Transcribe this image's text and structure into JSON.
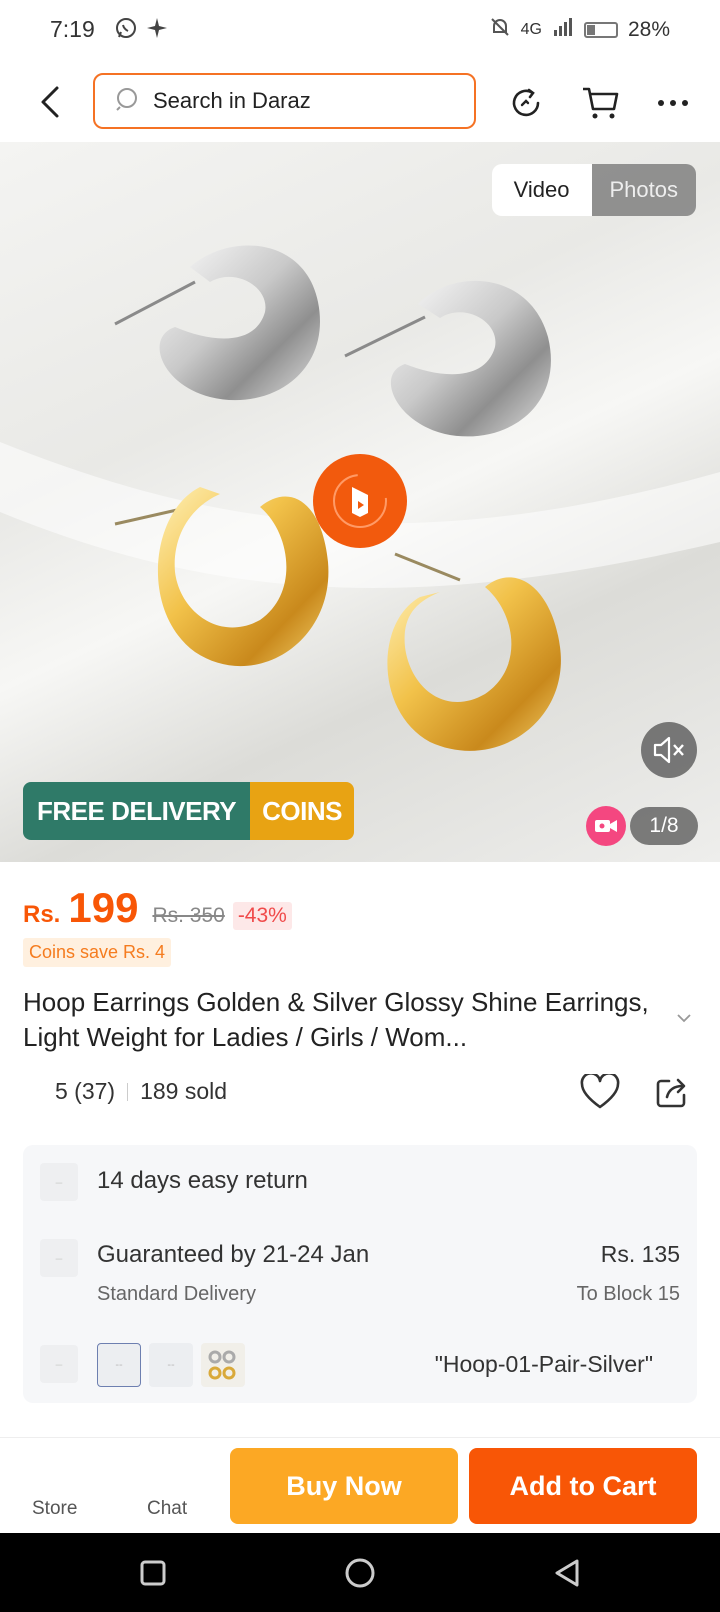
{
  "status_bar": {
    "time": "7:19",
    "network": "4G",
    "battery": "28%",
    "battery_level": 0.28
  },
  "header": {
    "search_placeholder": "Search in Daraz"
  },
  "media": {
    "toggle_video": "Video",
    "toggle_photos": "Photos",
    "promo_free_delivery": "FREE DELIVERY",
    "promo_coins": "COINS",
    "page_counter": "1/8"
  },
  "price": {
    "currency": "Rs.",
    "current": "199",
    "original": "Rs. 350",
    "discount": "-43%",
    "coins_save": "Coins save Rs. 4"
  },
  "product": {
    "title": "Hoop Earrings Golden & Silver Glossy Shine Earrings, Light Weight for Ladies / Girls / Wom...",
    "rating": "5 (37)",
    "sold": "189 sold"
  },
  "info": {
    "return_policy": "14 days easy return",
    "delivery_guarantee": "Guaranteed by 21-24 Jan",
    "delivery_type": "Standard Delivery",
    "delivery_price": "Rs. 135",
    "delivery_location": "To Block 15",
    "selected_variant": "\"Hoop-01-Pair-Silver\""
  },
  "bottom_bar": {
    "store_label": "Store",
    "chat_label": "Chat",
    "buy_now": "Buy Now",
    "add_to_cart": "Add to Cart"
  },
  "colors": {
    "accent": "#f85606",
    "buy_now": "#fca824",
    "promo_green": "#2f7a68",
    "promo_gold": "#e8a313"
  }
}
